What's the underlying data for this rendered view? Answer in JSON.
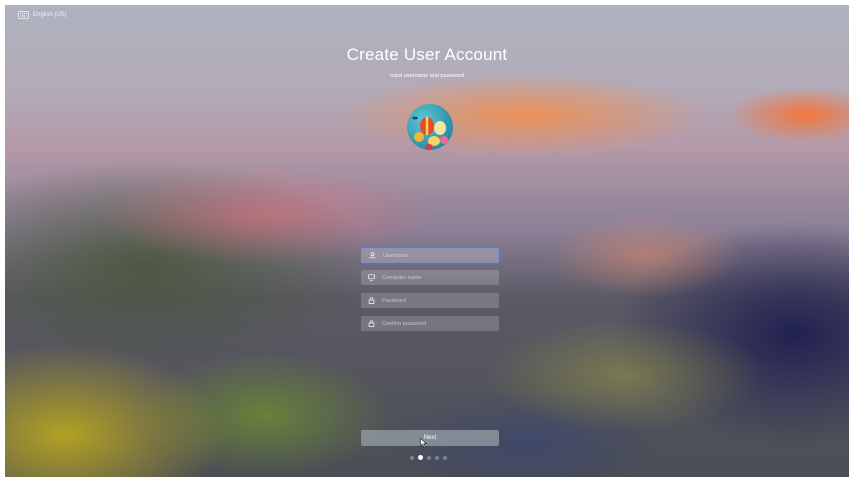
{
  "topbar": {
    "language": "English (US)",
    "keyboard_icon": "keyboard-icon"
  },
  "header": {
    "title": "Create User Account",
    "subtitle": "Input username and password"
  },
  "avatar": {
    "icon": "hot-air-balloons-avatar"
  },
  "form": {
    "username": {
      "placeholder": "Username",
      "icon": "user-icon"
    },
    "computer_name": {
      "placeholder": "Computer name",
      "icon": "monitor-icon"
    },
    "password": {
      "placeholder": "Password",
      "icon": "lock-icon"
    },
    "confirm_password": {
      "placeholder": "Confirm password",
      "icon": "lock-icon"
    }
  },
  "next_button": {
    "label": "Next"
  },
  "pager": {
    "total": 5,
    "current": 2
  },
  "colors": {
    "accent": "#6e96dc",
    "text": "#ffffff"
  }
}
